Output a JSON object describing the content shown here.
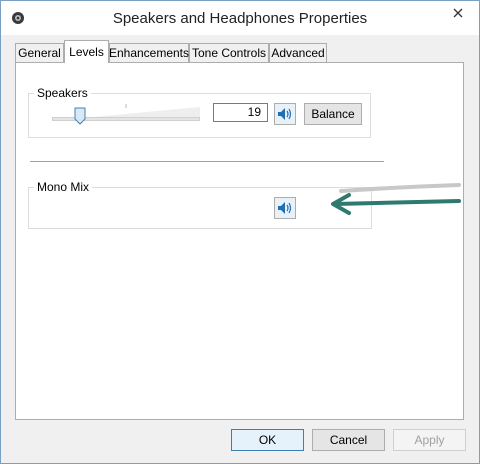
{
  "window": {
    "title": "Speakers and Headphones Properties"
  },
  "tabs": [
    {
      "label": "General"
    },
    {
      "label": "Levels"
    },
    {
      "label": "Enhancements"
    },
    {
      "label": "Tone Controls"
    },
    {
      "label": "Advanced"
    }
  ],
  "active_tab": "Levels",
  "levels": {
    "speakers": {
      "label": "Speakers",
      "value": "19",
      "slider_fraction": 0.19,
      "balance_label": "Balance",
      "mute_icon": "speaker-icon"
    },
    "mono_mix": {
      "label": "Mono Mix",
      "mute_icon": "speaker-icon"
    }
  },
  "footer": {
    "ok_label": "OK",
    "cancel_label": "Cancel",
    "apply_label": "Apply"
  },
  "colors": {
    "accent": "#3c7fb1",
    "annotation_arrow": "#2e7a6e"
  }
}
